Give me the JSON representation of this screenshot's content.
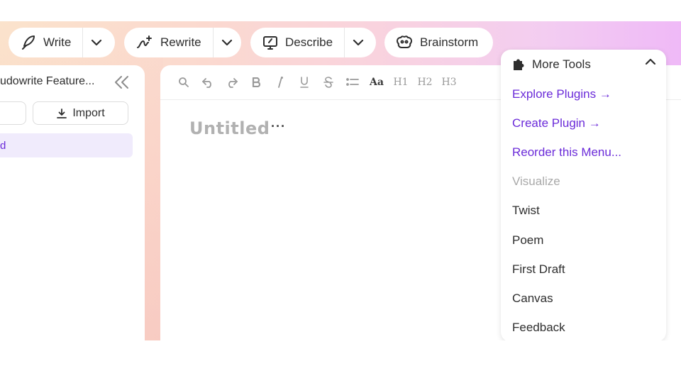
{
  "toolbar": {
    "write_label": "Write",
    "rewrite_label": "Rewrite",
    "describe_label": "Describe",
    "brainstorm_label": "Brainstorm",
    "more_tools_label": "More Tools"
  },
  "sidebar": {
    "title": "udowrite Feature...",
    "import_label": "Import",
    "active_item": "d"
  },
  "editor": {
    "format_tools": [
      "search-icon",
      "undo-icon",
      "redo-icon",
      "bold",
      "italic",
      "underline",
      "strikethrough",
      "list",
      "font-size",
      "heading-1",
      "heading-2",
      "heading-3"
    ],
    "font_size_label": "Aa",
    "h1_label": "H1",
    "h2_label": "H2",
    "h3_label": "H3",
    "document_title": "Untitled",
    "more_label": "···"
  },
  "more_tools_menu": {
    "explore_plugins": "Explore Plugins →",
    "create_plugin": "Create Plugin →",
    "reorder_menu": "Reorder this Menu...",
    "visualize": "Visualize",
    "twist": "Twist",
    "poem": "Poem",
    "first_draft": "First Draft",
    "canvas": "Canvas",
    "feedback": "Feedback"
  },
  "colors": {
    "accent": "#6b2bd9",
    "active_bg": "#f0ebfc",
    "disabled_text": "#a9a9a9",
    "gradient_start": "#fbe3cc",
    "gradient_end": "#efb9f7"
  }
}
